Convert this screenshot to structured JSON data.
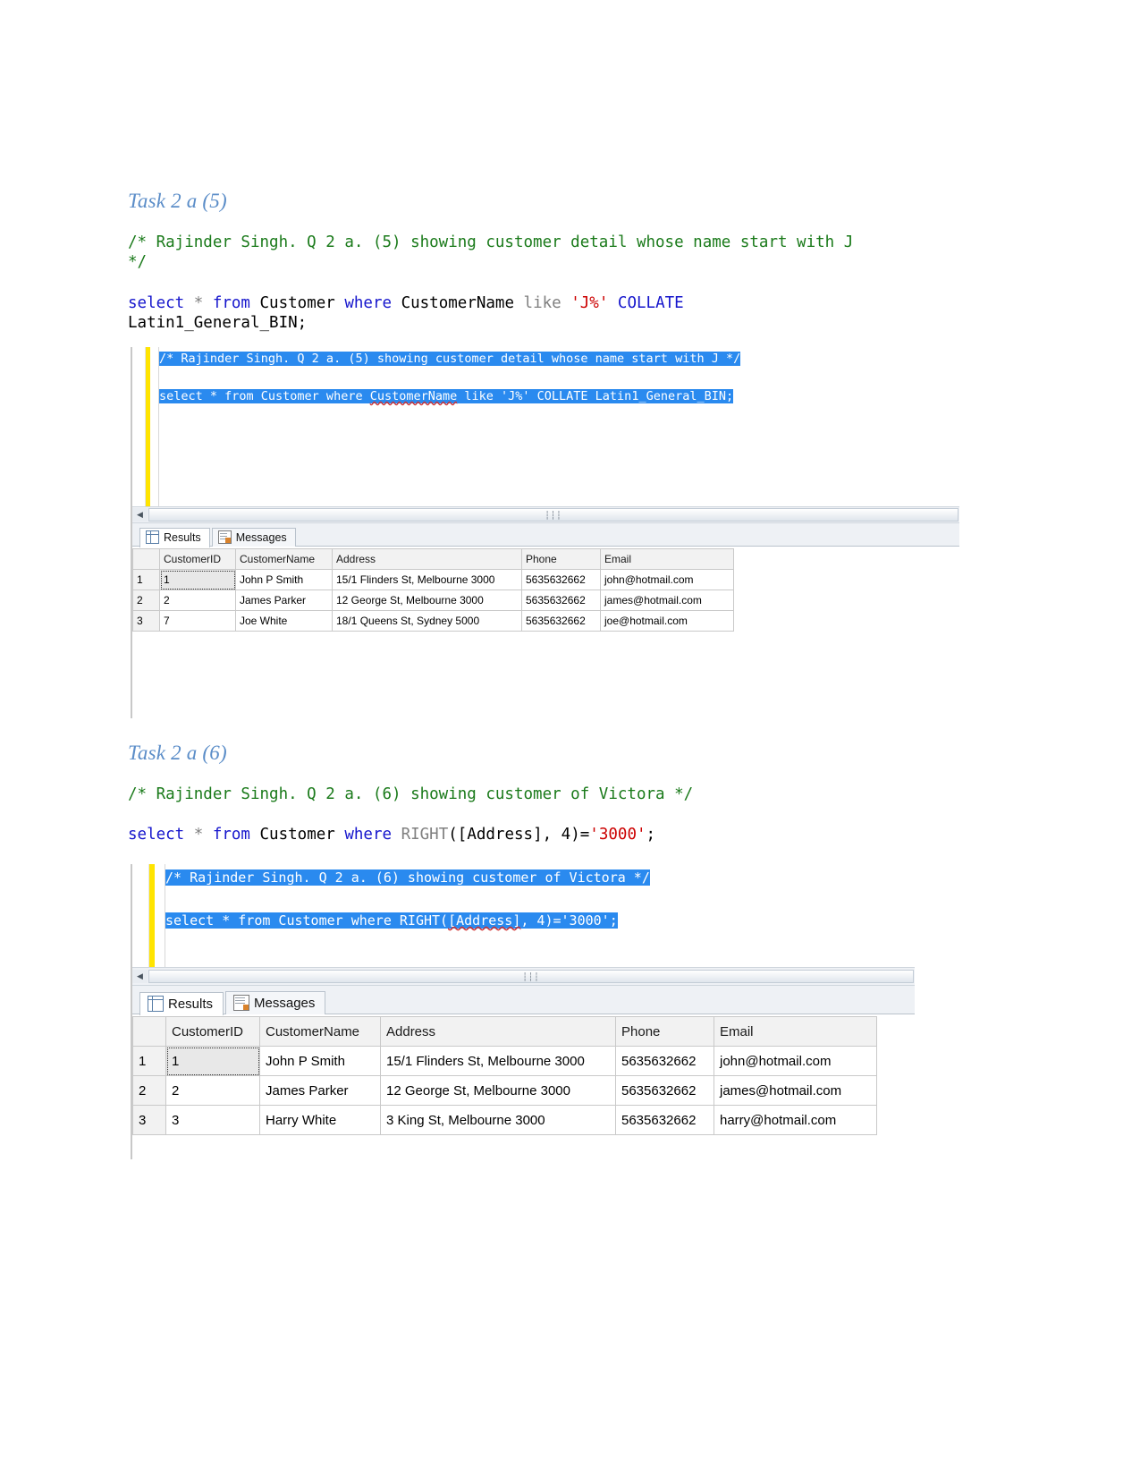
{
  "document": {
    "sections": [
      {
        "heading": "Task 2 a (5)",
        "comment_line1": "/* Rajinder Singh. Q 2 a. (5) showing customer detail whose name start with J",
        "comment_line2": "*/",
        "sql": {
          "select": "select",
          "star": " * ",
          "from": "from",
          "table": " Customer ",
          "where": "where",
          "column": " CustomerName ",
          "like": "like",
          "pattern": " 'J%' ",
          "collate": "COLLATE",
          "collation": "Latin1_General_BIN;"
        },
        "editor": {
          "line1": "/* Rajinder Singh. Q 2 a. (5) showing customer detail whose name start with J */",
          "line2": "",
          "line3_a": "select * from Customer where ",
          "line3_b": "CustomerName",
          "line3_c": " like 'J%' COLLATE Latin1_General_BIN;"
        },
        "tabs": [
          {
            "label": "Results",
            "icon": "grid-icon",
            "active": true
          },
          {
            "label": "Messages",
            "icon": "messages-icon",
            "active": false
          }
        ],
        "grid": {
          "columns": [
            "",
            "CustomerID",
            "CustomerName",
            "Address",
            "Phone",
            "Email"
          ],
          "rows": [
            {
              "n": "1",
              "cells": [
                "1",
                "John P Smith",
                "15/1 Flinders St, Melbourne 3000",
                "5635632662",
                "john@hotmail.com"
              ]
            },
            {
              "n": "2",
              "cells": [
                "2",
                "James Parker",
                "12 George St, Melbourne 3000",
                "5635632662",
                "james@hotmail.com"
              ]
            },
            {
              "n": "3",
              "cells": [
                "7",
                "Joe White",
                "18/1 Queens St, Sydney 5000",
                "5635632662",
                "joe@hotmail.com"
              ]
            }
          ]
        }
      },
      {
        "heading": "Task 2 a (6)",
        "comment_line1": "/* Rajinder Singh. Q 2 a. (6) showing customer of Victora */",
        "comment_line2": "",
        "sql": {
          "select": "select",
          "star": " * ",
          "from": "from",
          "table": " Customer ",
          "where": "where",
          "fn": " RIGHT",
          "args": "([Address], 4)=",
          "value": "'3000'",
          "semi": ";"
        },
        "editor": {
          "line1": "/* Rajinder Singh. Q 2 a. (6) showing customer of Victora */",
          "line2": "",
          "line3_a": "select * from Customer where RIGHT(",
          "line3_b": "[Address]",
          "line3_c": ", 4)='3000';"
        },
        "tabs": [
          {
            "label": "Results",
            "icon": "grid-icon",
            "active": true
          },
          {
            "label": "Messages",
            "icon": "messages-icon",
            "active": false
          }
        ],
        "grid": {
          "columns": [
            "",
            "CustomerID",
            "CustomerName",
            "Address",
            "Phone",
            "Email"
          ],
          "rows": [
            {
              "n": "1",
              "cells": [
                "1",
                "John P Smith",
                "15/1 Flinders St, Melbourne 3000",
                "5635632662",
                "john@hotmail.com"
              ]
            },
            {
              "n": "2",
              "cells": [
                "2",
                "James Parker",
                "12 George St, Melbourne 3000",
                "5635632662",
                "james@hotmail.com"
              ]
            },
            {
              "n": "3",
              "cells": [
                "3",
                "Harry White",
                "3 King St, Melbourne 3000",
                "5635632662",
                "harry@hotmail.com"
              ]
            }
          ]
        }
      }
    ],
    "scrollbar": {
      "grip": "⦀",
      "left_arrow": "◀"
    }
  },
  "colors": {
    "heading": "#5b8dc8",
    "comment": "#1a7a1a",
    "keyword": "#1515cc",
    "string": "#cc0000",
    "selection": "#2a8aef",
    "gutter_change": "#ffe400"
  }
}
